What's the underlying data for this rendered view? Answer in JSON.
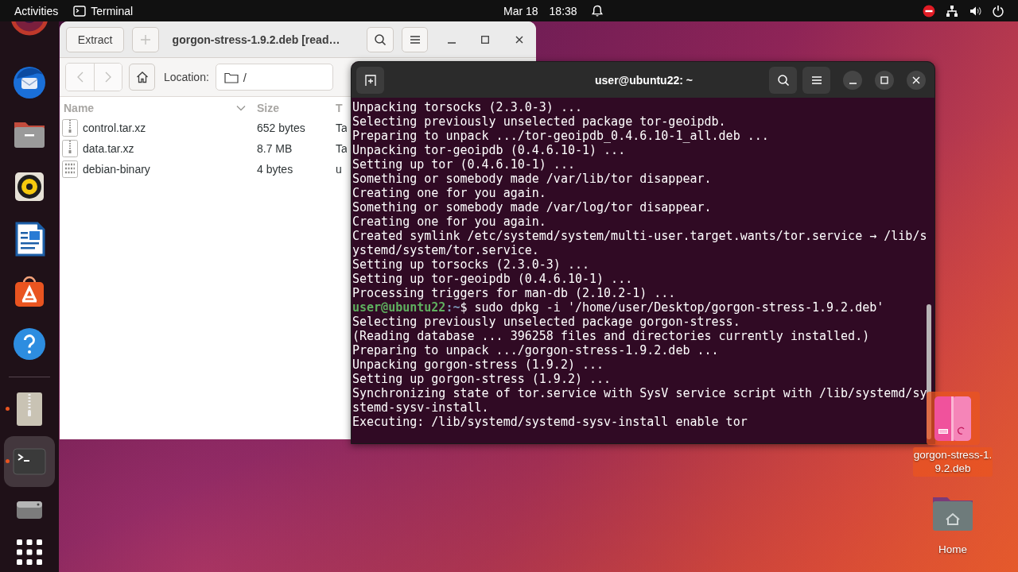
{
  "top_bar": {
    "activities": "Activities",
    "app_menu": "Terminal",
    "date": "Mar 18",
    "time": "18:38"
  },
  "dock": {
    "favorites": [
      {
        "kind": "browser",
        "running": false,
        "selected": false
      },
      {
        "kind": "mail",
        "running": false,
        "selected": false
      },
      {
        "kind": "files",
        "running": false,
        "selected": false
      },
      {
        "kind": "music",
        "running": false,
        "selected": false
      },
      {
        "kind": "writer",
        "running": false,
        "selected": false
      },
      {
        "kind": "store",
        "running": false,
        "selected": false
      },
      {
        "kind": "help",
        "running": false,
        "selected": false
      }
    ],
    "running_apps": [
      {
        "kind": "archive",
        "running": true,
        "selected": false
      },
      {
        "kind": "terminal",
        "running": true,
        "selected": true
      },
      {
        "kind": "drive",
        "running": false,
        "selected": false
      },
      {
        "kind": "apps",
        "running": false,
        "selected": false
      }
    ]
  },
  "archive_window": {
    "title": "gorgon-stress-1.9.2.deb [read…",
    "extract_button": "Extract",
    "location_label": "Location:",
    "location": "/",
    "columns": [
      {
        "label": "Name",
        "sorted": true
      },
      {
        "label": "Size",
        "sorted": false
      },
      {
        "label": "T",
        "sorted": false
      }
    ],
    "rows": [
      {
        "kind": "archive",
        "name": "control.tar.xz",
        "size": "652 bytes",
        "column_3": "Ta"
      },
      {
        "kind": "archive",
        "name": "data.tar.xz",
        "size": "8.7 MB",
        "column_3": "Ta"
      },
      {
        "kind": "binary",
        "name": "debian-binary",
        "size": "4 bytes",
        "column_3": "u"
      }
    ]
  },
  "terminal_window": {
    "title": "user@ubuntu22: ~",
    "lines": [
      {
        "kind": "output",
        "text": "Unpacking torsocks (2.3.0-3) ..."
      },
      {
        "kind": "output",
        "text": "Selecting previously unselected package tor-geoipdb."
      },
      {
        "kind": "output",
        "text": "Preparing to unpack .../tor-geoipdb_0.4.6.10-1_all.deb ..."
      },
      {
        "kind": "output",
        "text": "Unpacking tor-geoipdb (0.4.6.10-1) ..."
      },
      {
        "kind": "output",
        "text": "Setting up tor (0.4.6.10-1) ..."
      },
      {
        "kind": "output",
        "text": "Something or somebody made /var/lib/tor disappear."
      },
      {
        "kind": "output",
        "text": "Creating one for you again."
      },
      {
        "kind": "output",
        "text": "Something or somebody made /var/log/tor disappear."
      },
      {
        "kind": "output",
        "text": "Creating one for you again."
      },
      {
        "kind": "output",
        "text": "Created symlink /etc/systemd/system/multi-user.target.wants/tor.service → /lib/s"
      },
      {
        "kind": "output",
        "text": "ystemd/system/tor.service."
      },
      {
        "kind": "output",
        "text": "Setting up torsocks (2.3.0-3) ..."
      },
      {
        "kind": "output",
        "text": "Setting up tor-geoipdb (0.4.6.10-1) ..."
      },
      {
        "kind": "output",
        "text": "Processing triggers for man-db (2.10.2-1) ..."
      },
      {
        "kind": "prompt",
        "user": "user@ubuntu22",
        "path": ":~",
        "command": "$ sudo dpkg -i '/home/user/Desktop/gorgon-stress-1.9.2.deb'"
      },
      {
        "kind": "output",
        "text": "Selecting previously unselected package gorgon-stress."
      },
      {
        "kind": "output",
        "text": "(Reading database ... 396258 files and directories currently installed.)"
      },
      {
        "kind": "output",
        "text": "Preparing to unpack .../gorgon-stress-1.9.2.deb ..."
      },
      {
        "kind": "output",
        "text": "Unpacking gorgon-stress (1.9.2) ..."
      },
      {
        "kind": "output",
        "text": "Setting up gorgon-stress (1.9.2) ..."
      },
      {
        "kind": "output",
        "text": "Synchronizing state of tor.service with SysV service script with /lib/systemd/sy"
      },
      {
        "kind": "output",
        "text": "stemd-sysv-install."
      },
      {
        "kind": "output",
        "text": "Executing: /lib/systemd/systemd-sysv-install enable tor"
      }
    ]
  },
  "desktop_icons": [
    {
      "kind": "package",
      "label": "gorgon-stress-1.9.2.deb",
      "selected": true
    },
    {
      "kind": "folder",
      "label": "Home",
      "selected": false
    }
  ]
}
